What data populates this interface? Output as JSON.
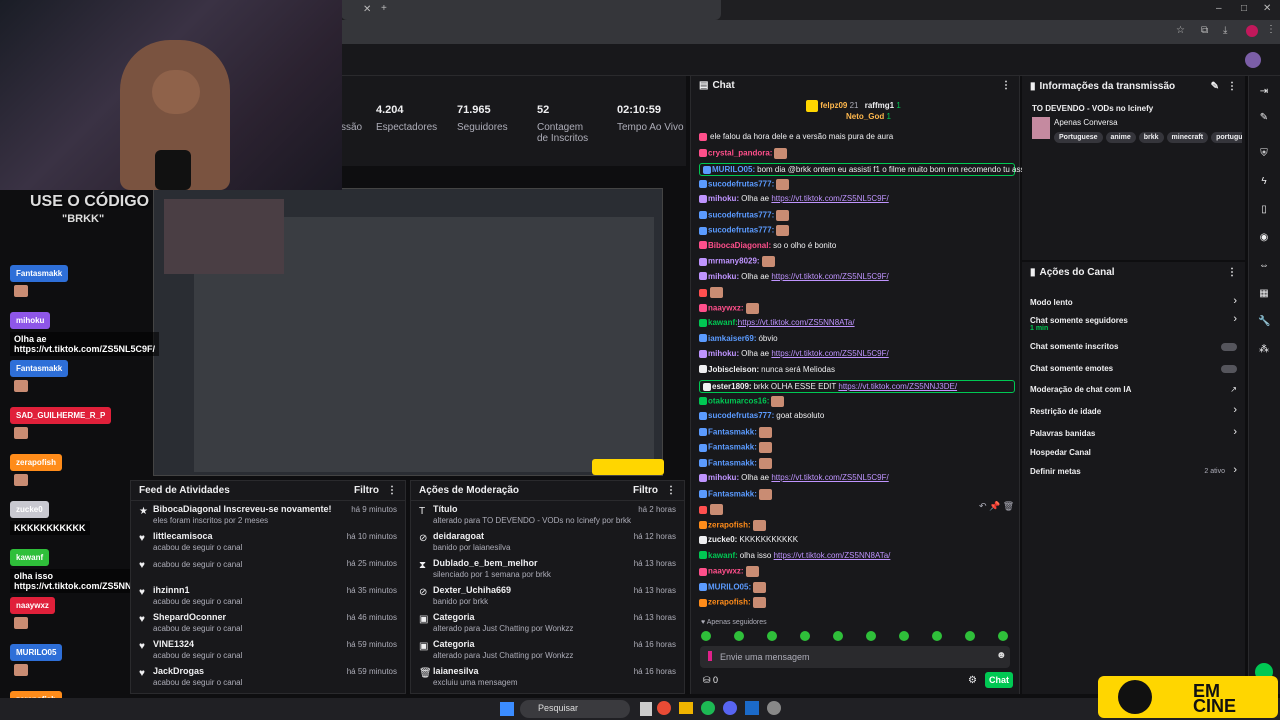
{
  "stats": [
    {
      "value": "4.204",
      "label": "Espectadores"
    },
    {
      "value": "71.965",
      "label": "Seguidores"
    },
    {
      "value": "52",
      "label": "Contagem de Inscritos"
    },
    {
      "value": "02:10:59",
      "label": "Tempo Ao Vivo"
    }
  ],
  "stats_partial_label": "ssão",
  "webcam_overlay": {
    "code_line1": "USE O CÓDIGO",
    "code_line2": "\"BRKK\""
  },
  "feed": {
    "title": "Feed de Atividades",
    "filter": "Filtro",
    "rows": [
      {
        "title": "BibocaDiagonal Inscreveu-se novamente!",
        "sub": "eles foram inscritos por 2 meses",
        "time": "há 9 minutos",
        "icon": "star-icon"
      },
      {
        "title": "littlecamisoca",
        "sub": "acabou de seguir o canal",
        "time": "há 10 minutos",
        "icon": "heart-icon"
      },
      {
        "title": "",
        "sub": "acabou de seguir o canal",
        "time": "há 25 minutos",
        "icon": "heart-icon"
      },
      {
        "title": "ihzinnn1",
        "sub": "acabou de seguir o canal",
        "time": "há 35 minutos",
        "icon": "heart-icon"
      },
      {
        "title": "ShepardOconner",
        "sub": "acabou de seguir o canal",
        "time": "há 46 minutos",
        "icon": "heart-icon"
      },
      {
        "title": "VINE1324",
        "sub": "acabou de seguir o canal",
        "time": "há 59 minutos",
        "icon": "heart-icon"
      },
      {
        "title": "JackDrogas",
        "sub": "acabou de seguir o canal",
        "time": "há 59 minutos",
        "icon": "heart-icon"
      }
    ]
  },
  "mod": {
    "title": "Ações de Moderação",
    "filter": "Filtro",
    "rows": [
      {
        "title": "Título",
        "sub": "alterado para TO DEVENDO - VODs no Icinefy por brkk",
        "time": "há 2 horas",
        "icon": "text-icon"
      },
      {
        "title": "deidaragoat",
        "sub": "banido por laianesilva",
        "time": "há 12 horas",
        "icon": "ban-icon"
      },
      {
        "title": "Dublado_e_bem_melhor",
        "sub": "silenciado por 1 semana por brkk",
        "time": "há 13 horas",
        "icon": "hourglass-icon"
      },
      {
        "title": "Dexter_Uchiha669",
        "sub": "banido por brkk",
        "time": "há 13 horas",
        "icon": "ban-icon"
      },
      {
        "title": "Categoria",
        "sub": "alterado para Just Chatting por Wonkzz",
        "time": "há 13 horas",
        "icon": "category-icon"
      },
      {
        "title": "Categoria",
        "sub": "alterado para Just Chatting por Wonkzz",
        "time": "há 16 horas",
        "icon": "category-icon"
      },
      {
        "title": "laianesilva",
        "sub": "excluiu uma mensagem",
        "time": "há 16 horas",
        "icon": "trash-icon"
      }
    ]
  },
  "chat": {
    "title": "Chat",
    "pinned": {
      "user1": "felpz09",
      "count1": "21",
      "user2": "raffmg1",
      "count2": "1",
      "user3": "Neto_God",
      "count3": "1"
    },
    "messages": [
      {
        "user": "",
        "color": "#ff4f8b",
        "text": "ele falou da hora dele e a versão mais pura de aura",
        "emote": false
      },
      {
        "user": "crystal_pandora:",
        "color": "#ff4f8b",
        "text": "",
        "emote": true
      },
      {
        "user": "MURILO05:",
        "color": "#5b9bff",
        "text": "bom dia @brkk ontem eu assisti f1 o filme muito bom mn recomendo tu assistir",
        "emote": false,
        "hl": true
      },
      {
        "user": "sucodefrutas777:",
        "color": "#5b9bff",
        "text": "",
        "emote": true
      },
      {
        "user": "mihoku:",
        "color": "#bf94ff",
        "text": "Olha ae ",
        "link": "https://vt.tiktok.com/ZS5NL5C9F/",
        "emote": false
      },
      {
        "user": "sucodefrutas777:",
        "color": "#5b9bff",
        "text": "",
        "emote": true
      },
      {
        "user": "sucodefrutas777:",
        "color": "#5b9bff",
        "text": "",
        "emote": true
      },
      {
        "user": "BibocaDiagonal:",
        "color": "#ff4f8b",
        "text": "so o olho é bonito",
        "emote": false
      },
      {
        "user": "mrmany8029:",
        "color": "#bf94ff",
        "text": "",
        "emote": true
      },
      {
        "user": "mihoku:",
        "color": "#bf94ff",
        "text": "Olha ae ",
        "link": "https://vt.tiktok.com/ZS5NL5C9F/",
        "emote": false
      },
      {
        "user": "",
        "color": "#ff4f4f",
        "text": "",
        "emote": true
      },
      {
        "user": "naaywxz:",
        "color": "#ff4f8b",
        "text": "",
        "emote": true
      },
      {
        "user": "kawanf:",
        "color": "#00c853",
        "text": "",
        "link": "https://vt.tiktok.com/ZS5NN8ATa/",
        "emote": false
      },
      {
        "user": "iamkaiser69:",
        "color": "#5b9bff",
        "text": "óbvio",
        "emote": false
      },
      {
        "user": "mihoku:",
        "color": "#bf94ff",
        "text": "Olha ae ",
        "link": "https://vt.tiktok.com/ZS5NL5C9F/",
        "emote": false
      },
      {
        "user": "Jobiscleison:",
        "color": "#efeff1",
        "text": "nunca será Meliodas",
        "emote": false
      },
      {
        "user": "ester1809:",
        "color": "#efeff1",
        "text": "brkk OLHA ESSE EDIT ",
        "link": "https://vt.tiktok.com/ZS5NNJ3DE/",
        "emote": false,
        "hl": true
      },
      {
        "user": "otakumarcos16:",
        "color": "#00c853",
        "text": "",
        "emote": true
      },
      {
        "user": "sucodefrutas777:",
        "color": "#5b9bff",
        "text": "goat absoluto",
        "emote": false
      },
      {
        "user": "Fantasmakk:",
        "color": "#5b9bff",
        "text": "",
        "emote": true
      },
      {
        "user": "Fantasmakk:",
        "color": "#5b9bff",
        "text": "",
        "emote": true
      },
      {
        "user": "Fantasmakk:",
        "color": "#5b9bff",
        "text": "",
        "emote": true
      },
      {
        "user": "mihoku:",
        "color": "#bf94ff",
        "text": "Olha ae ",
        "link": "https://vt.tiktok.com/ZS5NL5C9F/",
        "emote": false
      },
      {
        "user": "Fantasmakk:",
        "color": "#5b9bff",
        "text": "",
        "emote": true
      },
      {
        "user": "",
        "color": "#ff4f4f",
        "text": "",
        "emote": true
      },
      {
        "user": "zerapofish:",
        "color": "#ff8c1a",
        "text": "",
        "emote": true
      },
      {
        "user": "zucke0:",
        "color": "#efeff1",
        "text": "KKKKKKKKKKK",
        "emote": false
      },
      {
        "user": "kawanf:",
        "color": "#00c853",
        "text": "olha isso ",
        "link": "https://vt.tiktok.com/ZS5NN8ATa/",
        "emote": false
      },
      {
        "user": "naaywxz:",
        "color": "#ff4f8b",
        "text": "",
        "emote": true
      },
      {
        "user": "MURILO05:",
        "color": "#5b9bff",
        "text": "",
        "emote": true
      },
      {
        "user": "zerapofish:",
        "color": "#ff8c1a",
        "text": "",
        "emote": true
      }
    ],
    "followers_only": "Apenas seguidores",
    "input_placeholder": "Envie uma mensagem",
    "points": "0",
    "send": "Chat"
  },
  "info": {
    "title": "Informações da transmissão",
    "stream_title": "TO DEVENDO - VODs no Icinefy",
    "category": "Apenas Conversa",
    "tags": [
      "Portuguese",
      "anime",
      "brkk",
      "minecraft",
      "português"
    ]
  },
  "actions": {
    "title": "Ações do Canal",
    "items": [
      {
        "label": "Modo lento",
        "kind": "chevron"
      },
      {
        "label": "Chat somente seguidores",
        "sub": "1 min",
        "kind": "chevron"
      },
      {
        "label": "Chat somente inscritos",
        "kind": "toggle"
      },
      {
        "label": "Chat somente emotes",
        "kind": "toggle"
      },
      {
        "label": "Moderação de chat com IA",
        "kind": "ext"
      },
      {
        "label": "Restrição de idade",
        "kind": "chevron"
      },
      {
        "label": "Palavras banidas",
        "kind": "chevron"
      },
      {
        "label": "Hospedar Canal",
        "kind": "none"
      },
      {
        "label": "Definir metas",
        "status": "2 ativo",
        "kind": "chevron"
      }
    ]
  },
  "overlay_chat": [
    {
      "user": "Fantasmakk",
      "color": "#2e6fd8",
      "text": ""
    },
    {
      "user": "mihoku",
      "color": "#8e56e8",
      "text": "Olha ae https://vt.tiktok.com/ZS5NL5C9F/"
    },
    {
      "user": "Fantasmakk",
      "color": "#2e6fd8",
      "text": ""
    },
    {
      "user": "SAD_GUILHERME_R_P",
      "color": "#e0203a",
      "text": ""
    },
    {
      "user": "zerapofish",
      "color": "#ff8c1a",
      "text": ""
    },
    {
      "user": "zucke0",
      "color": "#c8c8d0",
      "text": "KKKKKKKKKKK"
    },
    {
      "user": "kawanf",
      "color": "#2fbf3a",
      "text": "olha isso https://vt.tiktok.com/ZS5NN8ATa/"
    },
    {
      "user": "naaywxz",
      "color": "#e0203a",
      "text": ""
    },
    {
      "user": "MURILO05",
      "color": "#2e6fd8",
      "text": ""
    },
    {
      "user": "zerapofish",
      "color": "#ff8c1a",
      "text": ""
    }
  ],
  "taskbar": {
    "search": "Pesquisar"
  },
  "promo": {
    "text": "EM CINE"
  },
  "colors": {
    "accent": "#00c853",
    "bg": "#18181b",
    "twitch": "#bf94ff"
  }
}
